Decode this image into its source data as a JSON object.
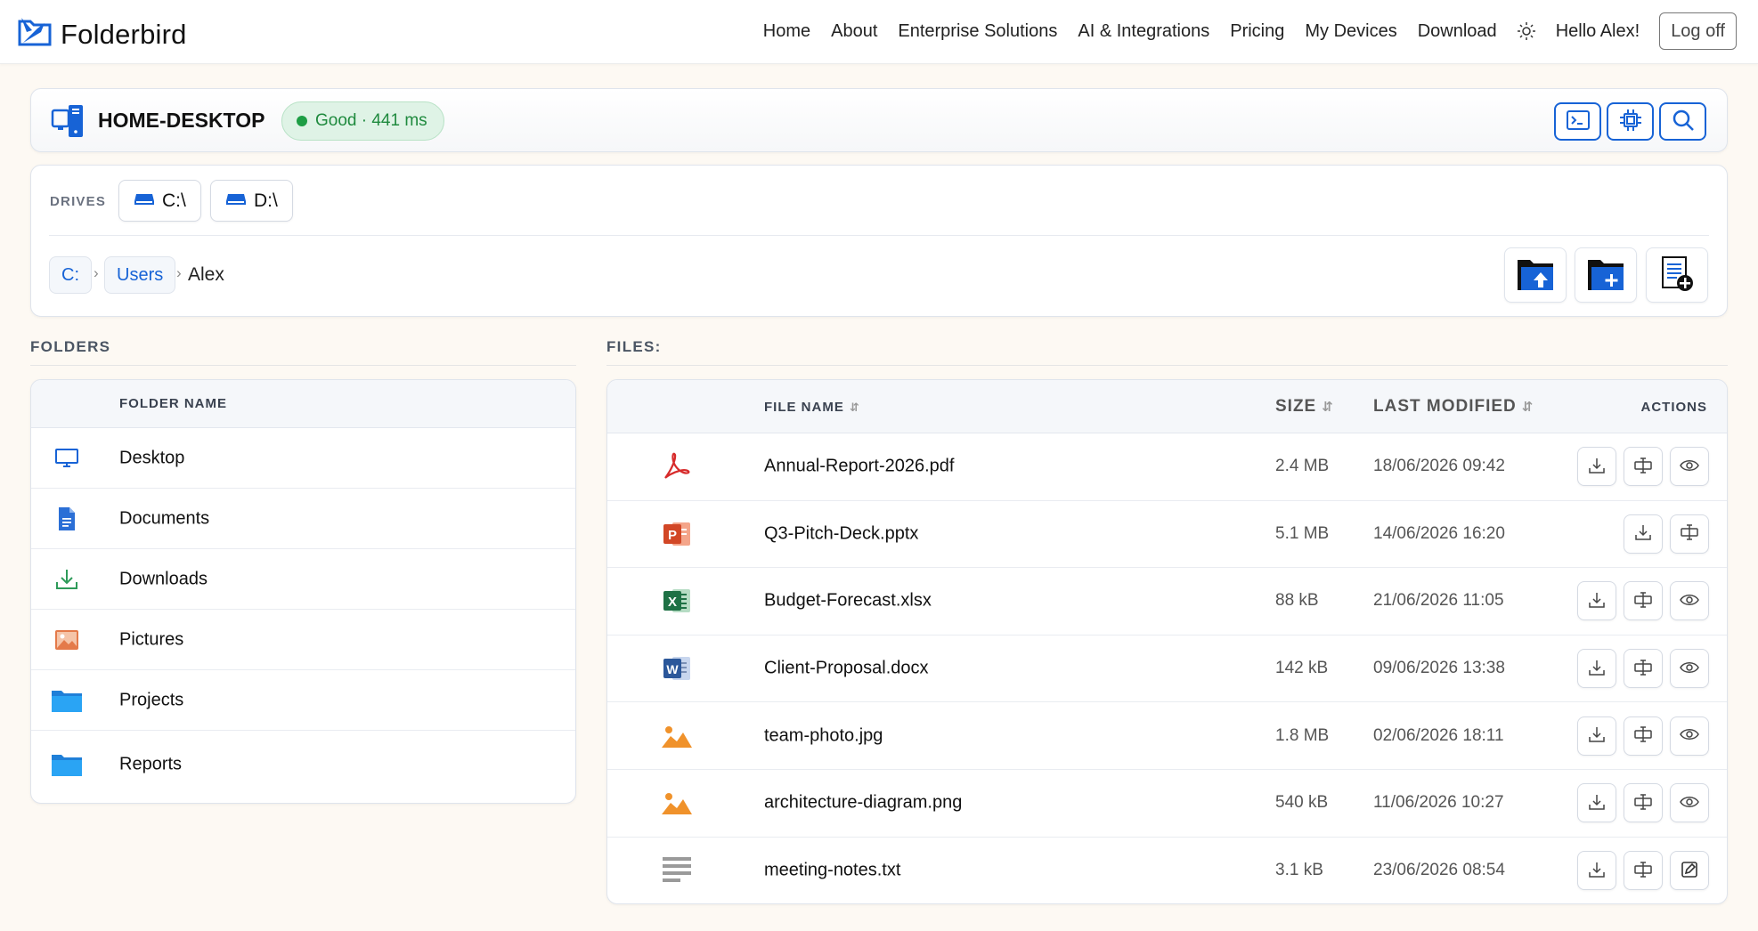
{
  "brand": {
    "name": "Folderbird"
  },
  "nav": {
    "links": [
      "Home",
      "About",
      "Enterprise Solutions",
      "AI & Integrations",
      "Pricing",
      "My Devices",
      "Download"
    ],
    "greeting": "Hello Alex!",
    "logoff_label": "Log off"
  },
  "device": {
    "name": "HOME-DESKTOP",
    "status": "Good · 441 ms",
    "status_color": "#1e9e45"
  },
  "drives": {
    "label": "DRIVES",
    "items": [
      "C:\\",
      "D:\\"
    ]
  },
  "breadcrumb": {
    "items": [
      "C:",
      "Users"
    ],
    "current": "Alex"
  },
  "folders": {
    "section_label": "FOLDERS",
    "column_header": "FOLDER NAME",
    "items": [
      {
        "name": "Desktop",
        "icon": "monitor-icon"
      },
      {
        "name": "Documents",
        "icon": "document-icon"
      },
      {
        "name": "Downloads",
        "icon": "download-icon"
      },
      {
        "name": "Pictures",
        "icon": "picture-icon"
      },
      {
        "name": "Projects",
        "icon": "folder-icon"
      },
      {
        "name": "Reports",
        "icon": "folder-icon"
      }
    ]
  },
  "files": {
    "section_label": "FILES:",
    "headers": {
      "name": "FILE NAME",
      "size": "SIZE",
      "modified": "LAST MODIFIED",
      "actions": "ACTIONS"
    },
    "items": [
      {
        "name": "Annual-Report-2026.pdf",
        "size": "2.4 MB",
        "modified": "18/06/2026 09:42",
        "icon": "pdf-icon"
      },
      {
        "name": "Q3-Pitch-Deck.pptx",
        "size": "5.1 MB",
        "modified": "14/06/2026 16:20",
        "icon": "powerpoint-icon"
      },
      {
        "name": "Budget-Forecast.xlsx",
        "size": "88 kB",
        "modified": "21/06/2026 11:05",
        "icon": "excel-icon"
      },
      {
        "name": "Client-Proposal.docx",
        "size": "142 kB",
        "modified": "09/06/2026 13:38",
        "icon": "word-icon"
      },
      {
        "name": "team-photo.jpg",
        "size": "1.8 MB",
        "modified": "02/06/2026 18:11",
        "icon": "image-icon"
      },
      {
        "name": "architecture-diagram.png",
        "size": "540 kB",
        "modified": "11/06/2026 10:27",
        "icon": "image-icon"
      },
      {
        "name": "meeting-notes.txt",
        "size": "3.1 kB",
        "modified": "23/06/2026 08:54",
        "icon": "text-file-icon"
      }
    ]
  },
  "colors": {
    "accent": "#1763d6",
    "status_bg": "#dff3e6",
    "page_bg": "#fdf9f3"
  }
}
